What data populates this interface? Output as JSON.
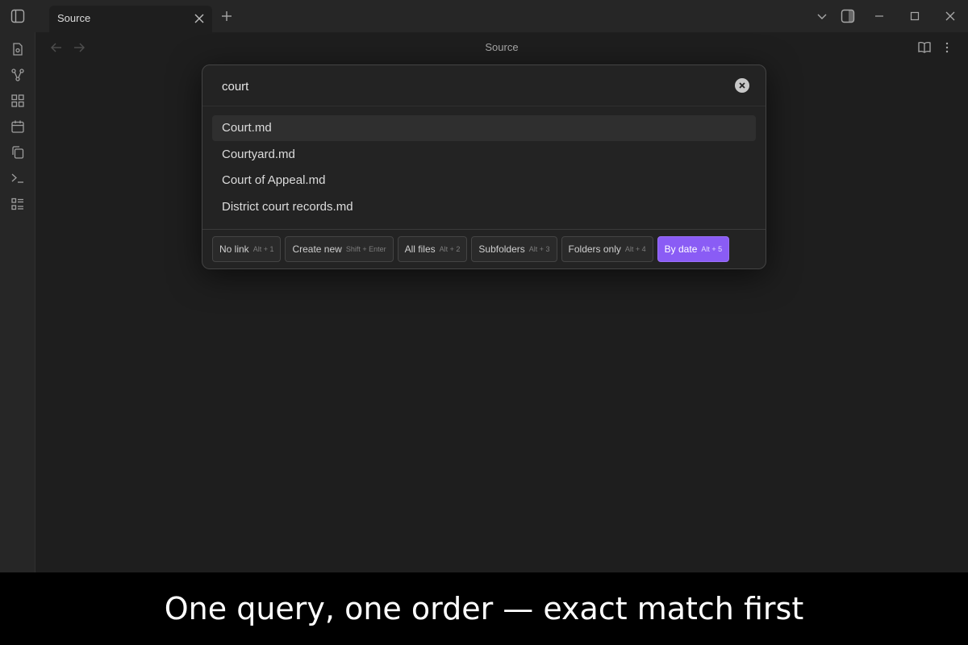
{
  "tabbar": {
    "tab_title": "Source"
  },
  "header": {
    "view_title": "Source"
  },
  "ribbon": {
    "icons": [
      "file-icon",
      "graph-icon",
      "grid-icon",
      "calendar-icon",
      "copy-icon",
      "terminal-icon",
      "list-icon"
    ]
  },
  "modal": {
    "search_value": "court",
    "results": [
      {
        "label": "Court.md",
        "selected": true
      },
      {
        "label": "Courtyard.md",
        "selected": false
      },
      {
        "label": "Court of Appeal.md",
        "selected": false
      },
      {
        "label": "District court records.md",
        "selected": false
      }
    ],
    "chips": [
      {
        "label": "No link",
        "key": "Alt + 1",
        "active": false
      },
      {
        "label": "Create new",
        "key": "Shift + Enter",
        "active": false
      },
      {
        "label": "All files",
        "key": "Alt + 2",
        "active": false
      },
      {
        "label": "Subfolders",
        "key": "Alt + 3",
        "active": false
      },
      {
        "label": "Folders only",
        "key": "Alt + 4",
        "active": false
      },
      {
        "label": "By date",
        "key": "Alt + 5",
        "active": true
      }
    ]
  },
  "colors": {
    "accent": "#8a5cf5",
    "background": "#1e1e1e",
    "panel": "#262626"
  },
  "caption": {
    "text": "One query, one order — exact match first"
  }
}
